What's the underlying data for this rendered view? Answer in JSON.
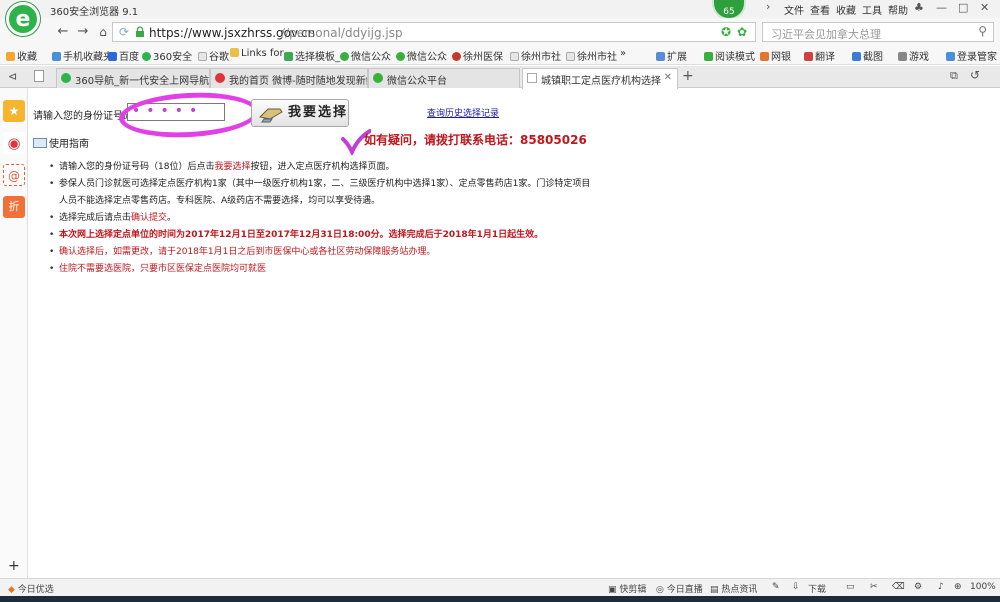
{
  "app": {
    "title": "360安全浏览器 9.1",
    "badge_count": "65",
    "menu": [
      "文件",
      "查看",
      "收藏",
      "工具",
      "帮助"
    ]
  },
  "address": {
    "host": "https://www.jsxzhrss.gov.cn",
    "path": "//personal/ddyijg.jsp",
    "search_placeholder": "习近平会见加拿大总理"
  },
  "bookmarks": {
    "left": [
      {
        "label": "收藏",
        "color": "#f0a830"
      },
      {
        "label": "手机收藏夹",
        "color": "#4a90d9"
      },
      {
        "label": "百度",
        "color": "#2a67d8"
      },
      {
        "label": "360安全",
        "color": "#2db34a"
      },
      {
        "label": "谷歌",
        "color": "#c7c7c7"
      },
      {
        "label": "Links for",
        "color": "#e6c24a"
      },
      {
        "label": "选择模板_",
        "color": "#3aaa55"
      },
      {
        "label": "微信公众",
        "color": "#37b13a"
      },
      {
        "label": "微信公众",
        "color": "#37b13a"
      },
      {
        "label": "徐州医保",
        "color": "#c0392b"
      },
      {
        "label": "徐州市社",
        "color": "#c7c7c7"
      },
      {
        "label": "徐州市社",
        "color": "#c7c7c7"
      }
    ],
    "more": "»",
    "right": [
      {
        "label": "扩展",
        "color": "#5b8bd6"
      },
      {
        "label": "阅读模式",
        "color": "#37b13a"
      },
      {
        "label": "网银",
        "color": "#e0772b"
      },
      {
        "label": "翻译",
        "color": "#d04040"
      },
      {
        "label": "截图",
        "color": "#3a7bd5"
      },
      {
        "label": "游戏",
        "color": "#888888"
      },
      {
        "label": "登录管家",
        "color": "#4a90d9"
      }
    ]
  },
  "tabs": [
    {
      "label": "360导航_新一代安全上网导航",
      "color": "#2db34a",
      "active": false
    },
    {
      "label": "我的首页 微博-随时随地发现新鲜",
      "color": "#e0343a",
      "active": false
    },
    {
      "label": "微信公众平台",
      "color": "#37b13a",
      "active": false
    },
    {
      "label": "城镇职工定点医疗机构选择",
      "color": "#c7c7c7",
      "active": true
    }
  ],
  "sidebar": [
    {
      "name": "favorites",
      "glyph": "★",
      "color": "#f5b52e"
    },
    {
      "name": "weibo",
      "glyph": "◉",
      "color": "#e0343a"
    },
    {
      "name": "mail",
      "glyph": "@",
      "color": "#e05b3a"
    },
    {
      "name": "discount",
      "glyph": "折",
      "color": "#f0703a"
    }
  ],
  "page": {
    "id_label": "请输入您的身份证号码",
    "id_value": "•••••",
    "choose_button": "我要选择",
    "history_link": "查询历史选择记录",
    "phone_notice": "如有疑问，请拨打联系电话：85805026",
    "guide_label": "使用指南",
    "notes": [
      {
        "segments": [
          {
            "text": "请输入您的身份证号码（18位）后点击",
            "style": ""
          },
          {
            "text": "我要选择",
            "style": "red"
          },
          {
            "text": "按钮，进入定点医疗机构选择页面。",
            "style": ""
          }
        ]
      },
      {
        "segments": [
          {
            "text": "参保人员门诊就医可选择定点医疗机构1家（其中一级医疗机构1家，二、三级医疗机构中选择1家）、定点零售药店1家。门诊特定项目",
            "style": ""
          }
        ]
      },
      {
        "sub": true,
        "segments": [
          {
            "text": "人员不能选择定点零售药店。专科医院、A级药店不需要选择，均可以享受待遇。",
            "style": ""
          }
        ]
      },
      {
        "segments": [
          {
            "text": "选择完成后请点击",
            "style": ""
          },
          {
            "text": "确认提交",
            "style": "red"
          },
          {
            "text": "。",
            "style": ""
          }
        ]
      },
      {
        "segments": [
          {
            "text": "本次网上选择定点单位的时间为2017年12月1日至2017年12月31日18:00分。选择完成后于2018年1月1日起生效。",
            "style": "red bold"
          }
        ]
      },
      {
        "segments": [
          {
            "text": "确认选择后，如需更改，请于2018年1月1日之后到市医保中心或各社区劳动保障服务站办理。",
            "style": "red"
          }
        ]
      },
      {
        "segments": [
          {
            "text": "住院不需要选医院，只要市区医保定点医院均可就医",
            "style": "red"
          }
        ]
      }
    ]
  },
  "status": {
    "left": "今日优选",
    "items": [
      "快剪辑",
      "今日直播",
      "热点资讯",
      "下载"
    ],
    "zoom": "100%"
  }
}
